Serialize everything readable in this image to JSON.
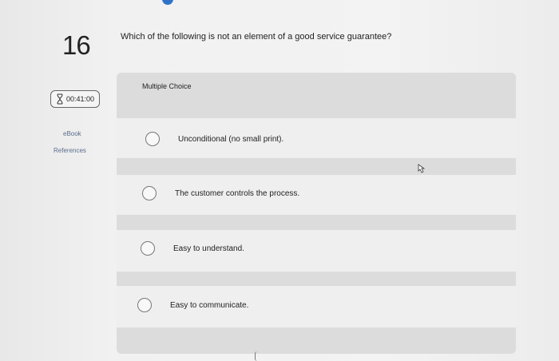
{
  "question": {
    "number": "16",
    "text": "Which of the following is not an element of a good service guarantee?"
  },
  "timer": {
    "value": "00:41:00",
    "icon": "hourglass-icon"
  },
  "links": {
    "ebook": "eBook",
    "references": "References"
  },
  "answer_section": {
    "type_label": "Multiple Choice",
    "options": [
      {
        "label": "Unconditional (no small print)."
      },
      {
        "label": "The customer controls the process."
      },
      {
        "label": "Easy to understand."
      },
      {
        "label": "Easy to communicate."
      }
    ]
  },
  "colors": {
    "top_indicator": "#2f73c9",
    "link": "#5a6d8d"
  }
}
